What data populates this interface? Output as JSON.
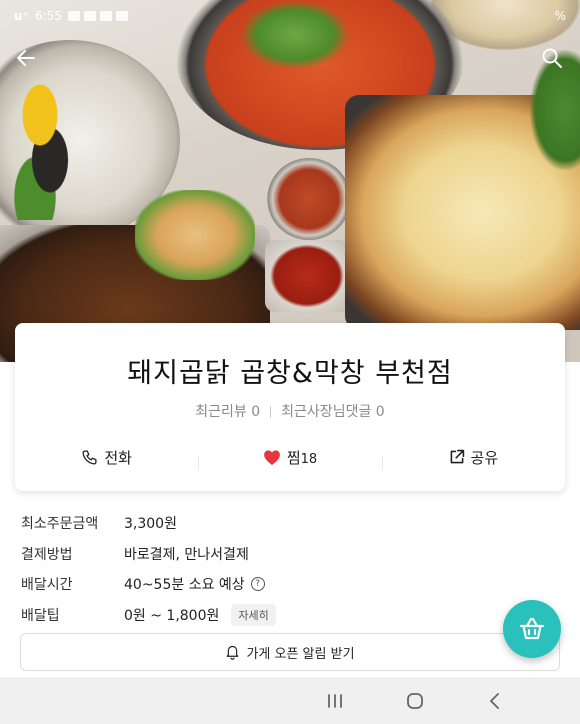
{
  "status_bar": {
    "carrier": "u⁺",
    "time": "6:55",
    "battery": "%"
  },
  "store": {
    "name": "돼지곱닭 곱창&막창 부천점",
    "recent_review": "최근리뷰 0",
    "recent_owner_comment": "최근사장님댓글 0"
  },
  "actions": {
    "call": "전화",
    "favorite_label": "찜",
    "favorite_count": "18",
    "share": "공유"
  },
  "info": {
    "rows": [
      {
        "label": "최소주문금액",
        "value": "3,300원"
      },
      {
        "label": "결제방법",
        "value": "바로결제, 만나서결제"
      },
      {
        "label": "배달시간",
        "value": "40~55분 소요 예상"
      },
      {
        "label": "배달팁",
        "value": "0원 ~ 1,800원"
      }
    ],
    "help_glyph": "?",
    "detail_chip": "자세히"
  },
  "notify_button": "가게 오픈 알림 받기",
  "colors": {
    "accent": "#2ac1bc",
    "heart": "#e5363d"
  }
}
